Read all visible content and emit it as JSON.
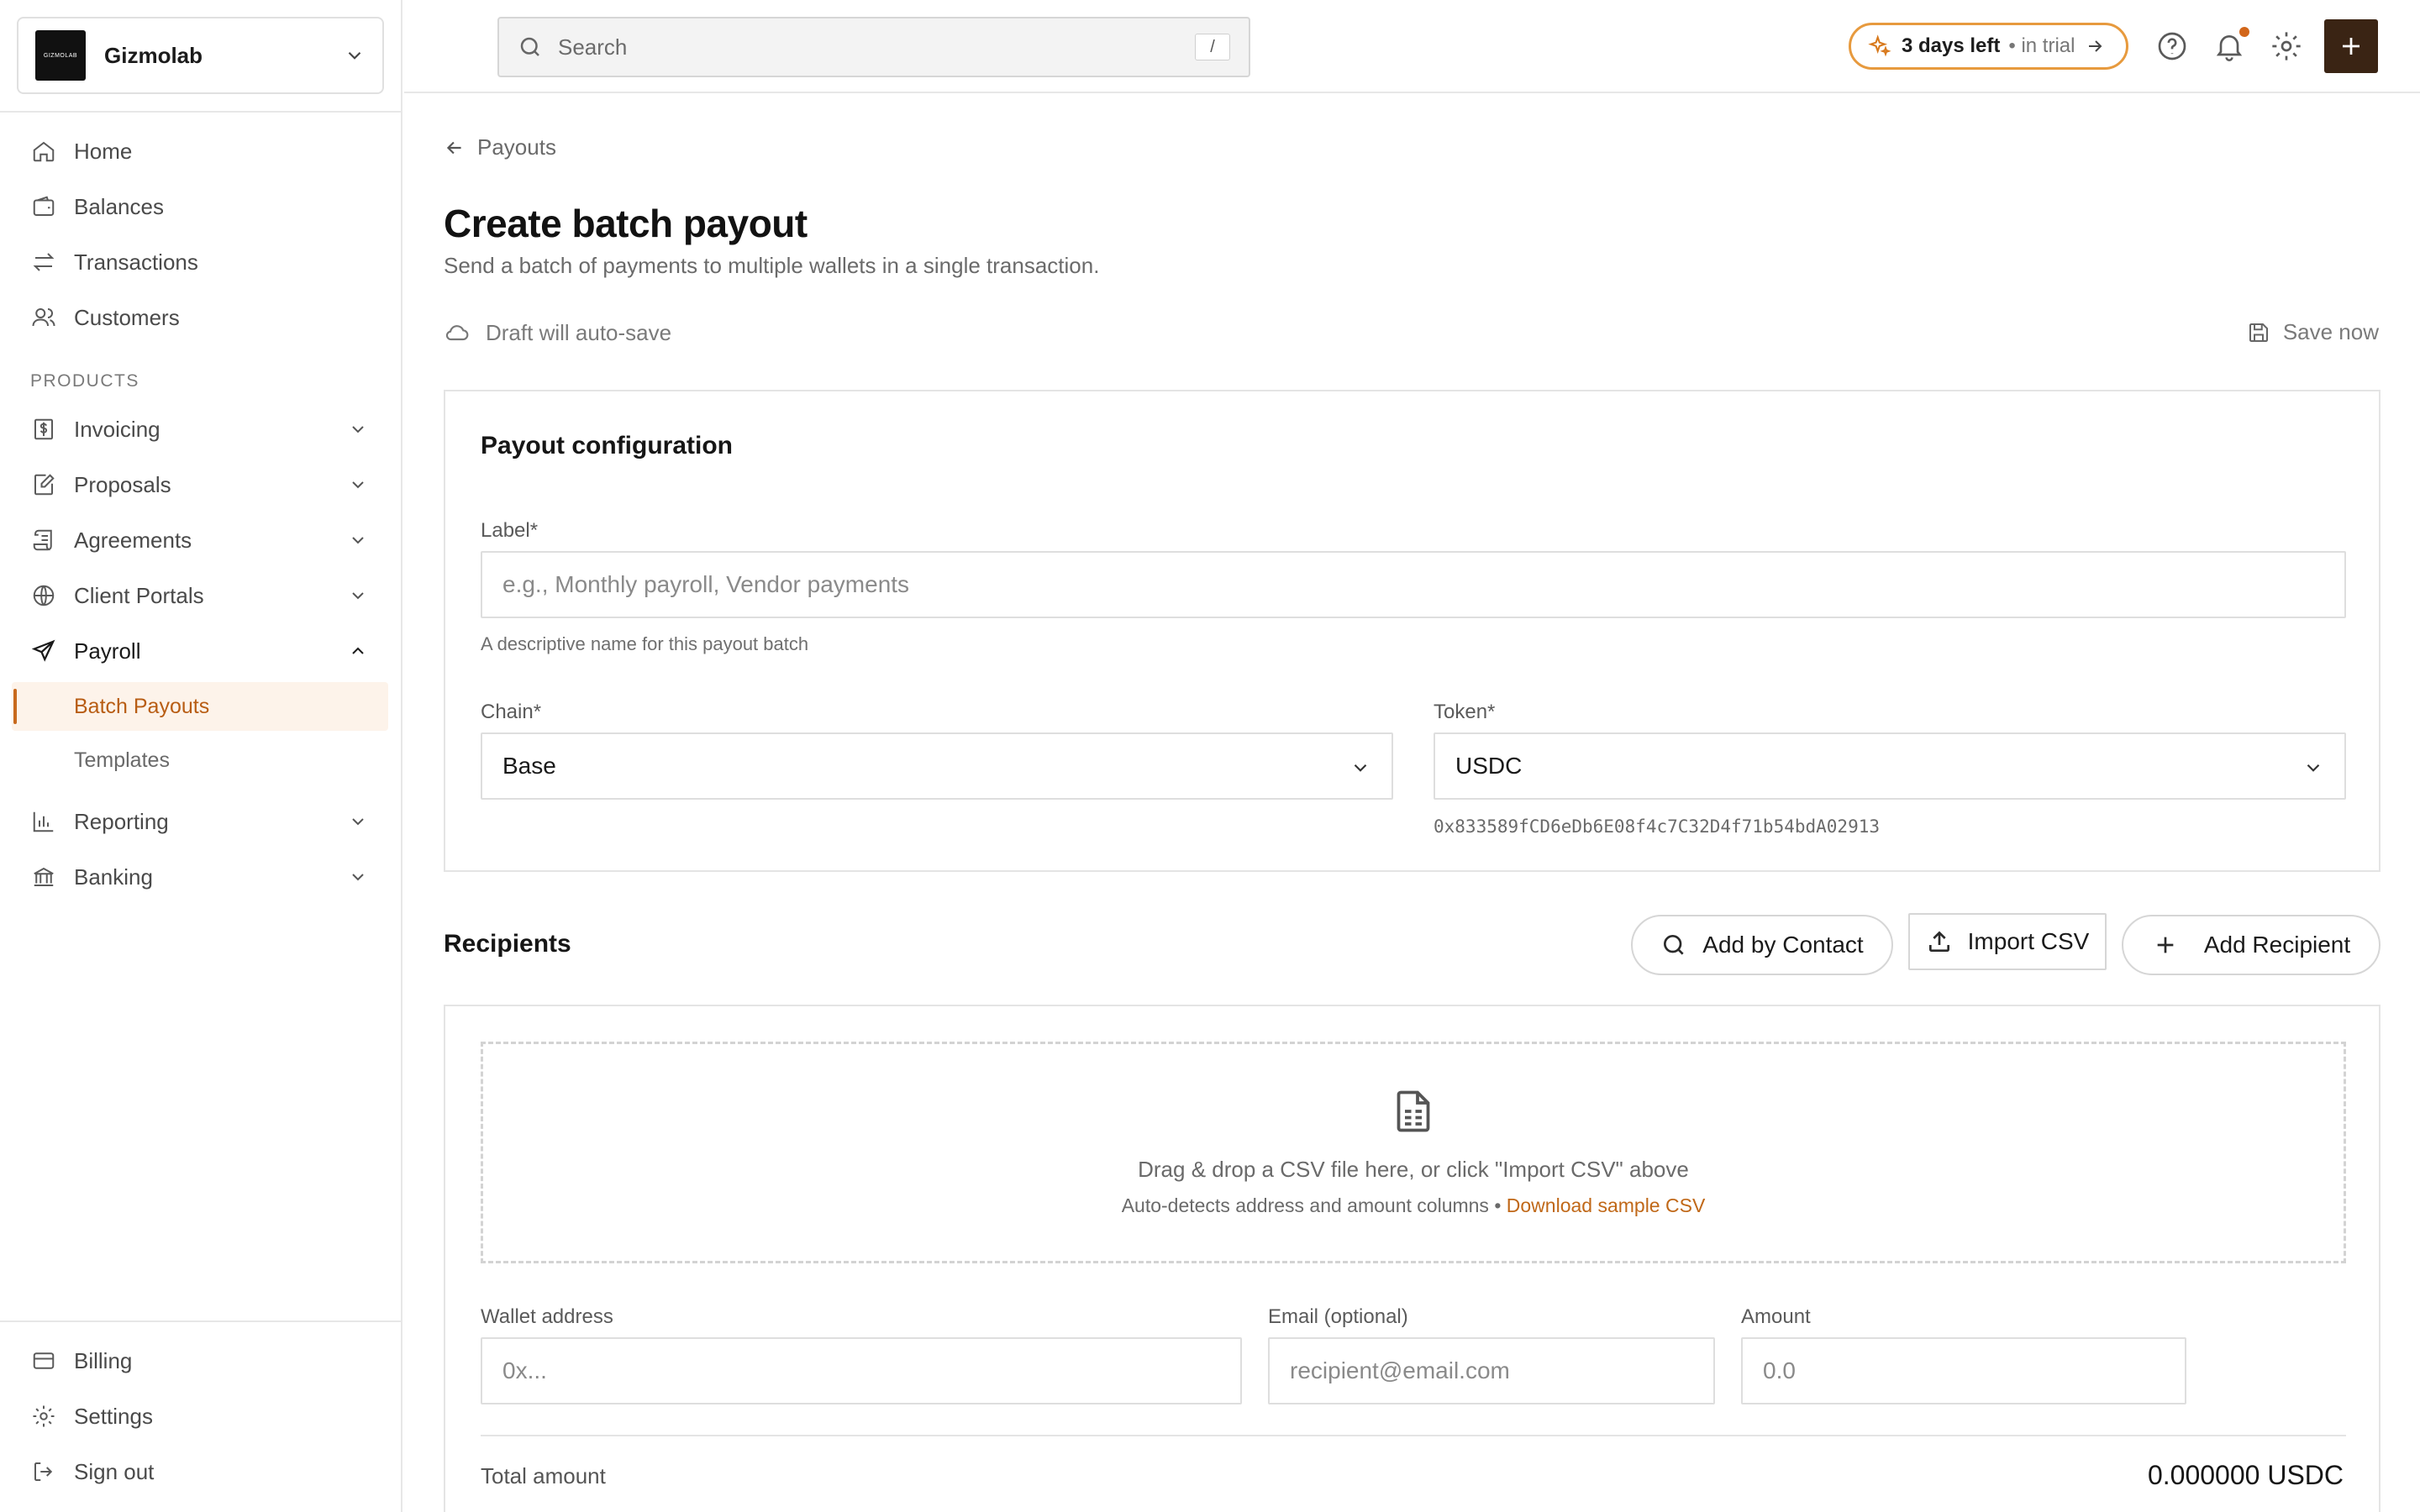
{
  "org": {
    "logo_text": "GIZMOLAB",
    "name": "Gizmolab"
  },
  "search": {
    "placeholder": "Search",
    "shortcut": "/"
  },
  "trial": {
    "days": "3 days left",
    "sub": "• in trial"
  },
  "sidebar": {
    "main_items": [
      {
        "label": "Home",
        "icon": "home-icon"
      },
      {
        "label": "Balances",
        "icon": "wallet-icon"
      },
      {
        "label": "Transactions",
        "icon": "arrows-icon"
      },
      {
        "label": "Customers",
        "icon": "users-icon"
      }
    ],
    "section_label": "PRODUCTS",
    "product_items": [
      {
        "label": "Invoicing",
        "icon": "dollar-doc-icon"
      },
      {
        "label": "Proposals",
        "icon": "edit-doc-icon"
      },
      {
        "label": "Agreements",
        "icon": "scroll-icon"
      },
      {
        "label": "Client Portals",
        "icon": "globe-icon"
      },
      {
        "label": "Payroll",
        "icon": "send-icon"
      }
    ],
    "payroll_sub": [
      {
        "label": "Batch Payouts",
        "active": true
      },
      {
        "label": "Templates",
        "active": false
      }
    ],
    "more_items": [
      {
        "label": "Reporting",
        "icon": "bar-chart-icon"
      },
      {
        "label": "Banking",
        "icon": "bank-icon"
      }
    ],
    "bottom_items": [
      {
        "label": "Billing",
        "icon": "card-icon"
      },
      {
        "label": "Settings",
        "icon": "gear-icon"
      },
      {
        "label": "Sign out",
        "icon": "sign-out-icon"
      }
    ]
  },
  "page": {
    "back": "Payouts",
    "title": "Create batch payout",
    "subtitle": "Send a batch of payments to multiple wallets in a single transaction.",
    "draft": "Draft will auto-save",
    "save_now": "Save now"
  },
  "config": {
    "title": "Payout configuration",
    "label_field": {
      "label": "Label*",
      "placeholder": "e.g., Monthly payroll, Vendor payments",
      "help": "A descriptive name for this payout batch"
    },
    "chain": {
      "label": "Chain*",
      "value": "Base"
    },
    "token": {
      "label": "Token*",
      "value": "USDC",
      "address": "0x833589fCD6eDb6E08f4c7C32D4f71b54bdA02913"
    }
  },
  "recipients": {
    "title": "Recipients",
    "add_by_contact": "Add by Contact",
    "import_csv": "Import CSV",
    "add_recipient": "Add Recipient",
    "dropzone": {
      "main": "Drag & drop a CSV file here, or click \"Import CSV\" above",
      "sub": "Auto-detects address and amount columns •",
      "link": "Download sample CSV"
    },
    "wallet": {
      "label": "Wallet address",
      "placeholder": "0x..."
    },
    "email": {
      "label": "Email (optional)",
      "placeholder": "recipient@email.com"
    },
    "amount": {
      "label": "Amount",
      "placeholder": "0.0"
    },
    "total_label": "Total amount",
    "total_value": "0.000000 USDC"
  },
  "colors": {
    "accent": "#c86a1e",
    "accent_bg": "#fdf3ea",
    "primary_dark": "#3a2414",
    "trial_border": "#e79a3e"
  }
}
